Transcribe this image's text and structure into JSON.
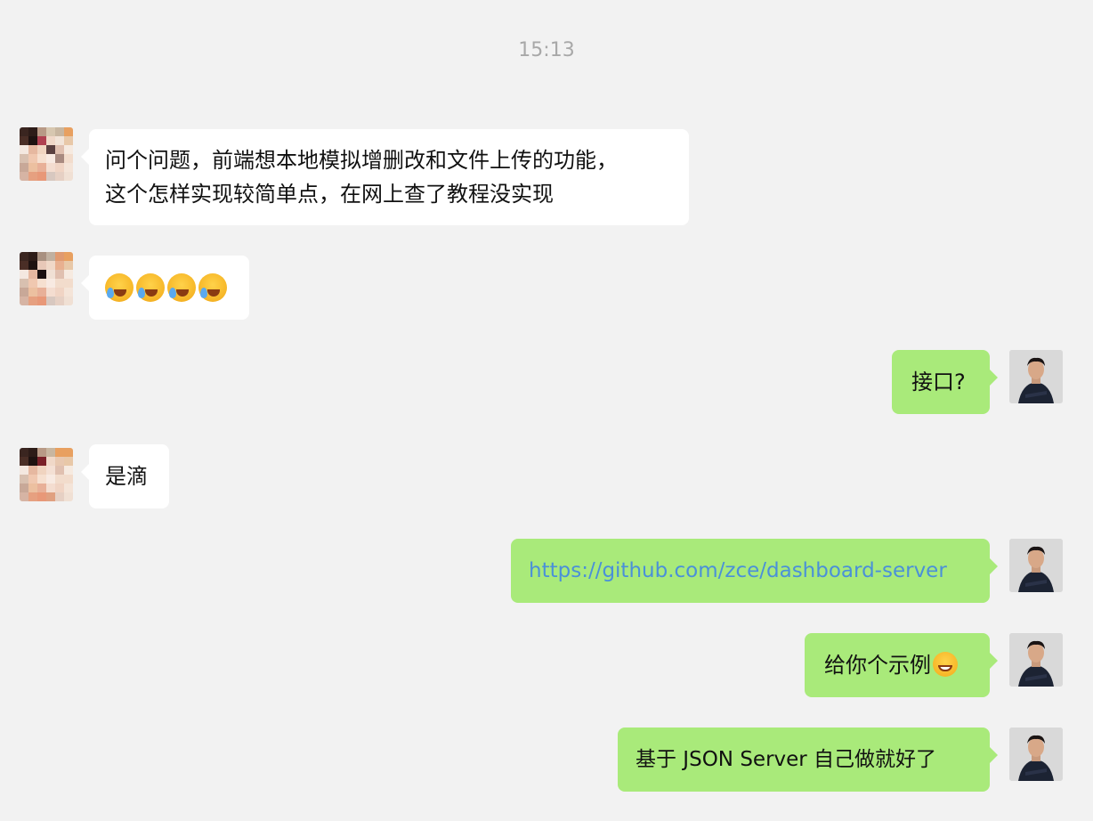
{
  "chat": {
    "timestamp": "15:13",
    "messages": [
      {
        "side": "in",
        "lines": [
          "问个问题，前端想本地模拟增删改和文件上传的功能，",
          "这个怎样实现较简单点，在网上查了教程没实现"
        ]
      },
      {
        "side": "in",
        "emoji": [
          "loudly-crying-face",
          "loudly-crying-face",
          "loudly-crying-face",
          "loudly-crying-face"
        ]
      },
      {
        "side": "out",
        "text": "接口?"
      },
      {
        "side": "in",
        "text": "是滴"
      },
      {
        "side": "out",
        "link": "https://github.com/zce/dashboard-server"
      },
      {
        "side": "out",
        "text": "给你个示例",
        "emoji": "grinning-face"
      },
      {
        "side": "out",
        "text": "基于 JSON Server 自己做就好了"
      }
    ]
  },
  "colors": {
    "background": "#f2f2f2",
    "incoming_bubble": "#ffffff",
    "outgoing_bubble": "#a9ea7a",
    "link": "#4a90d9",
    "timestamp": "#a8a8a8"
  }
}
